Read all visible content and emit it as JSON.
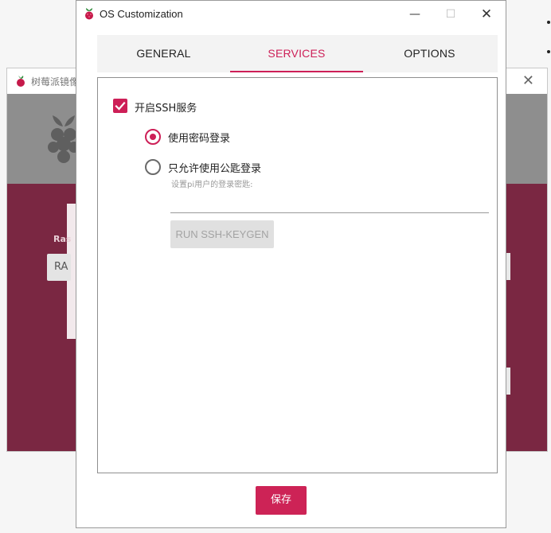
{
  "background_window": {
    "title": "树莓派镜像",
    "label": "Ras",
    "button_text": "RA"
  },
  "dialog": {
    "title": "OS Customization",
    "tabs": [
      "GENERAL",
      "SERVICES",
      "OPTIONS"
    ],
    "active_tab": "SERVICES",
    "services": {
      "ssh_enable_label": "开启SSH服务",
      "ssh_enabled": true,
      "auth_password_label": "使用密码登录",
      "auth_pubkey_label": "只允许使用公匙登录",
      "selected_auth": "password",
      "pubkey_hint": "设置pi用户的登录密匙:",
      "pubkey_value": "",
      "keygen_button": "RUN SSH-KEYGEN"
    },
    "save_button": "保存"
  },
  "icons": {
    "app": "raspberry-icon",
    "minimize": "minimize-icon",
    "maximize": "maximize-icon",
    "close": "close-icon",
    "check": "check-icon"
  },
  "colors": {
    "accent": "#cd1f57",
    "bg_header": "#8e8e8e",
    "bg_body": "#7a2742"
  }
}
